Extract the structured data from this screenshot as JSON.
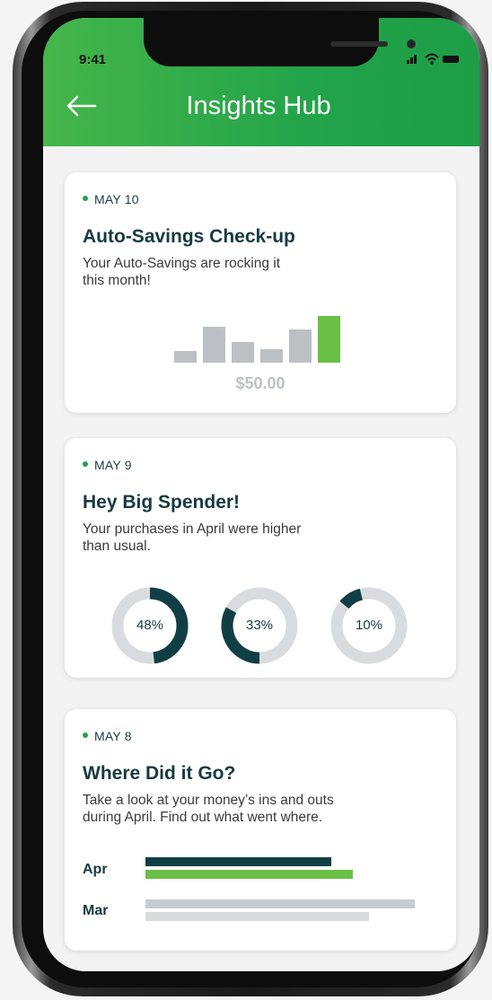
{
  "status_bar": {
    "time": "9:41"
  },
  "header": {
    "back_icon": "arrow-left-icon",
    "title": "Insights Hub"
  },
  "colors": {
    "brand_green": "#23a44a",
    "dark_teal": "#0f3f45",
    "muted_gray": "#bcc0c4"
  },
  "cards": [
    {
      "date": "MAY 10",
      "title": "Auto-Savings Check-up",
      "description_line1": "Your Auto-Savings are rocking it",
      "description_line2": "this month!",
      "chart": {
        "type": "bar",
        "relative_values": [
          0.25,
          0.77,
          0.44,
          0.29,
          0.71,
          1.0
        ],
        "highlighted_index": 5
      },
      "amount": "$50.00"
    },
    {
      "date": "MAY 9",
      "title": "Hey Big Spender!",
      "description_line1": "Your purchases in April were higher",
      "description_line2": "than usual.",
      "donuts": [
        {
          "label": "48%",
          "value": 48
        },
        {
          "label": "33%",
          "value": 33
        },
        {
          "label": "10%",
          "value": 10
        }
      ]
    },
    {
      "date": "MAY 8",
      "title": "Where Did it Go?",
      "description_line1": "Take a look at your money’s ins and outs",
      "description_line2": "during April. Find out what went where.",
      "rows": [
        {
          "label": "Apr",
          "bar1": 0.69,
          "bar2": 0.77
        },
        {
          "label": "Mar",
          "bar1": 1.0,
          "bar2": 0.83
        }
      ]
    }
  ]
}
